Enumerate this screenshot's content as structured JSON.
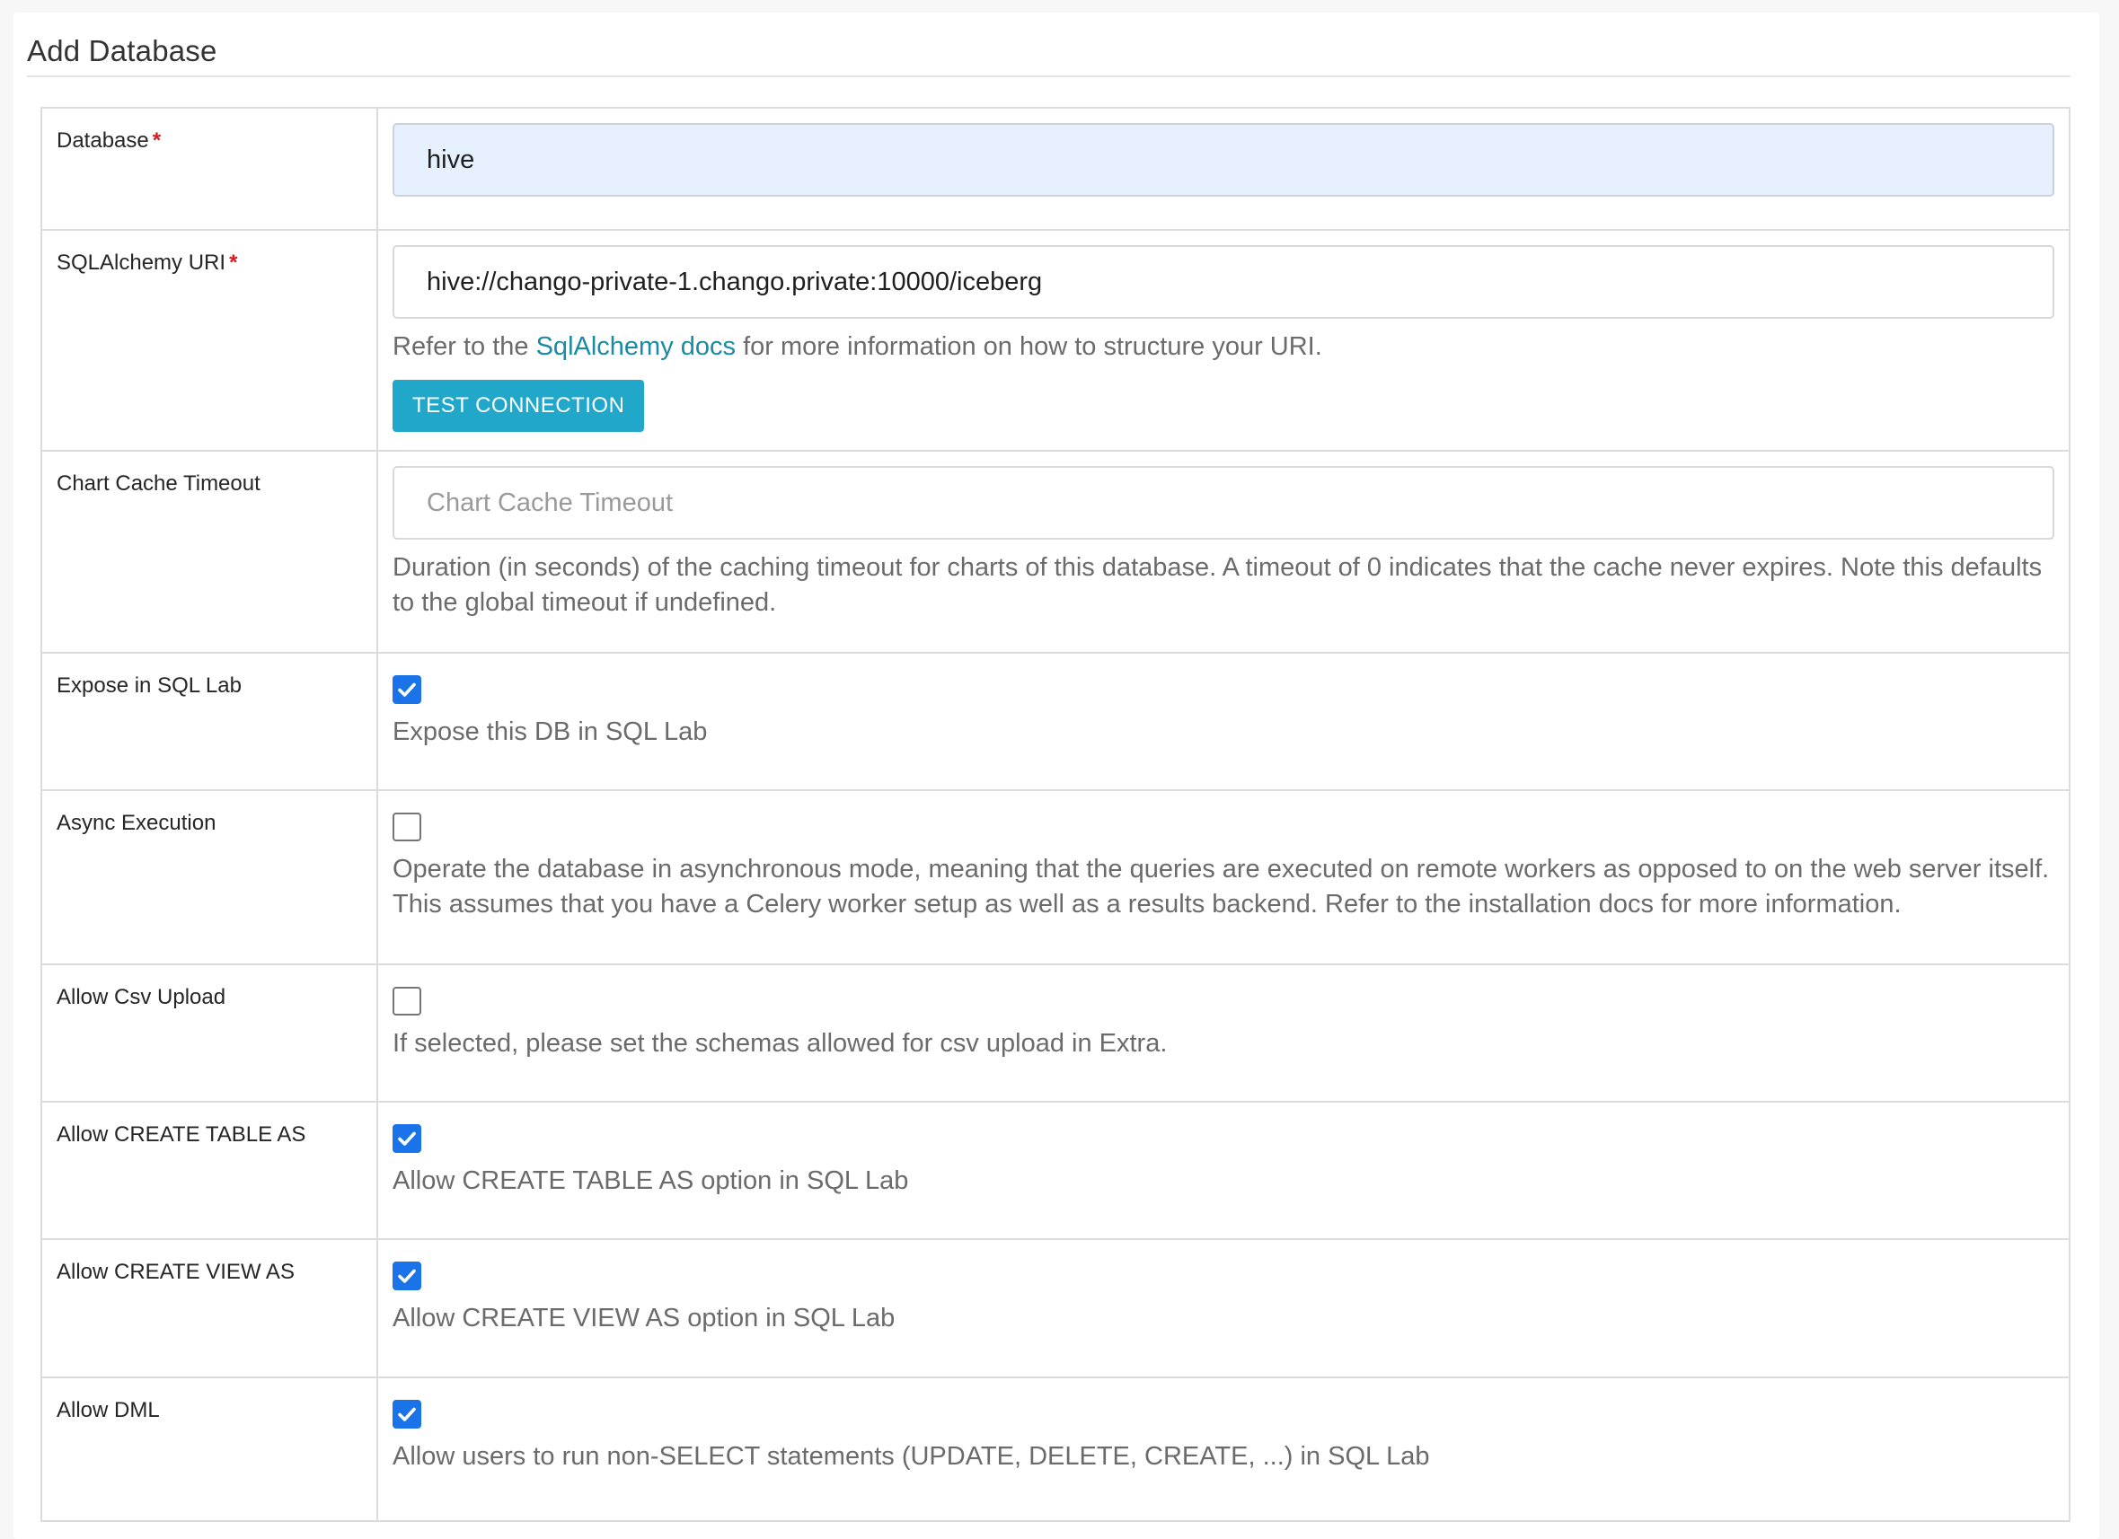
{
  "page": {
    "title": "Add Database"
  },
  "rows": [
    {
      "label": "Database",
      "required": "*",
      "value": "hive"
    },
    {
      "label": "SQLAlchemy URI",
      "required": "*",
      "value": "hive://chango-private-1.chango.private:10000/iceberg",
      "help_prefix": "Refer to the ",
      "help_link": "SqlAlchemy docs",
      "help_suffix": " for more information on how to structure your URI.",
      "button": "TEST CONNECTION"
    },
    {
      "label": "Chart Cache Timeout",
      "value": "",
      "placeholder": "Chart Cache Timeout",
      "help": "Duration (in seconds) of the caching timeout for charts of this database. A timeout of 0 indicates that the cache never expires. Note this defaults to the global timeout if undefined."
    },
    {
      "label": "Expose in SQL Lab",
      "checked": true,
      "help": "Expose this DB in SQL Lab"
    },
    {
      "label": "Async Execution",
      "checked": false,
      "help": "Operate the database in asynchronous mode, meaning that the queries are executed on remote workers as opposed to on the web server itself. This assumes that you have a Celery worker setup as well as a results backend. Refer to the installation docs for more information."
    },
    {
      "label": "Allow Csv Upload",
      "checked": false,
      "help": "If selected, please set the schemas allowed for csv upload in Extra."
    },
    {
      "label": "Allow CREATE TABLE AS",
      "checked": true,
      "help": "Allow CREATE TABLE AS option in SQL Lab"
    },
    {
      "label": "Allow CREATE VIEW AS",
      "checked": true,
      "help": "Allow CREATE VIEW AS option in SQL Lab"
    },
    {
      "label": "Allow DML",
      "checked": true,
      "help": "Allow users to run non-SELECT statements (UPDATE, DELETE, CREATE, ...) in SQL Lab"
    }
  ],
  "colors": {
    "checkbox_checked": "#1a73e8",
    "button_bg": "#20a7c9",
    "link": "#1b8ba3",
    "required": "#e0161f",
    "filled_input_bg": "#e7f0fe"
  },
  "icons": {
    "checkmark": "check-icon"
  }
}
